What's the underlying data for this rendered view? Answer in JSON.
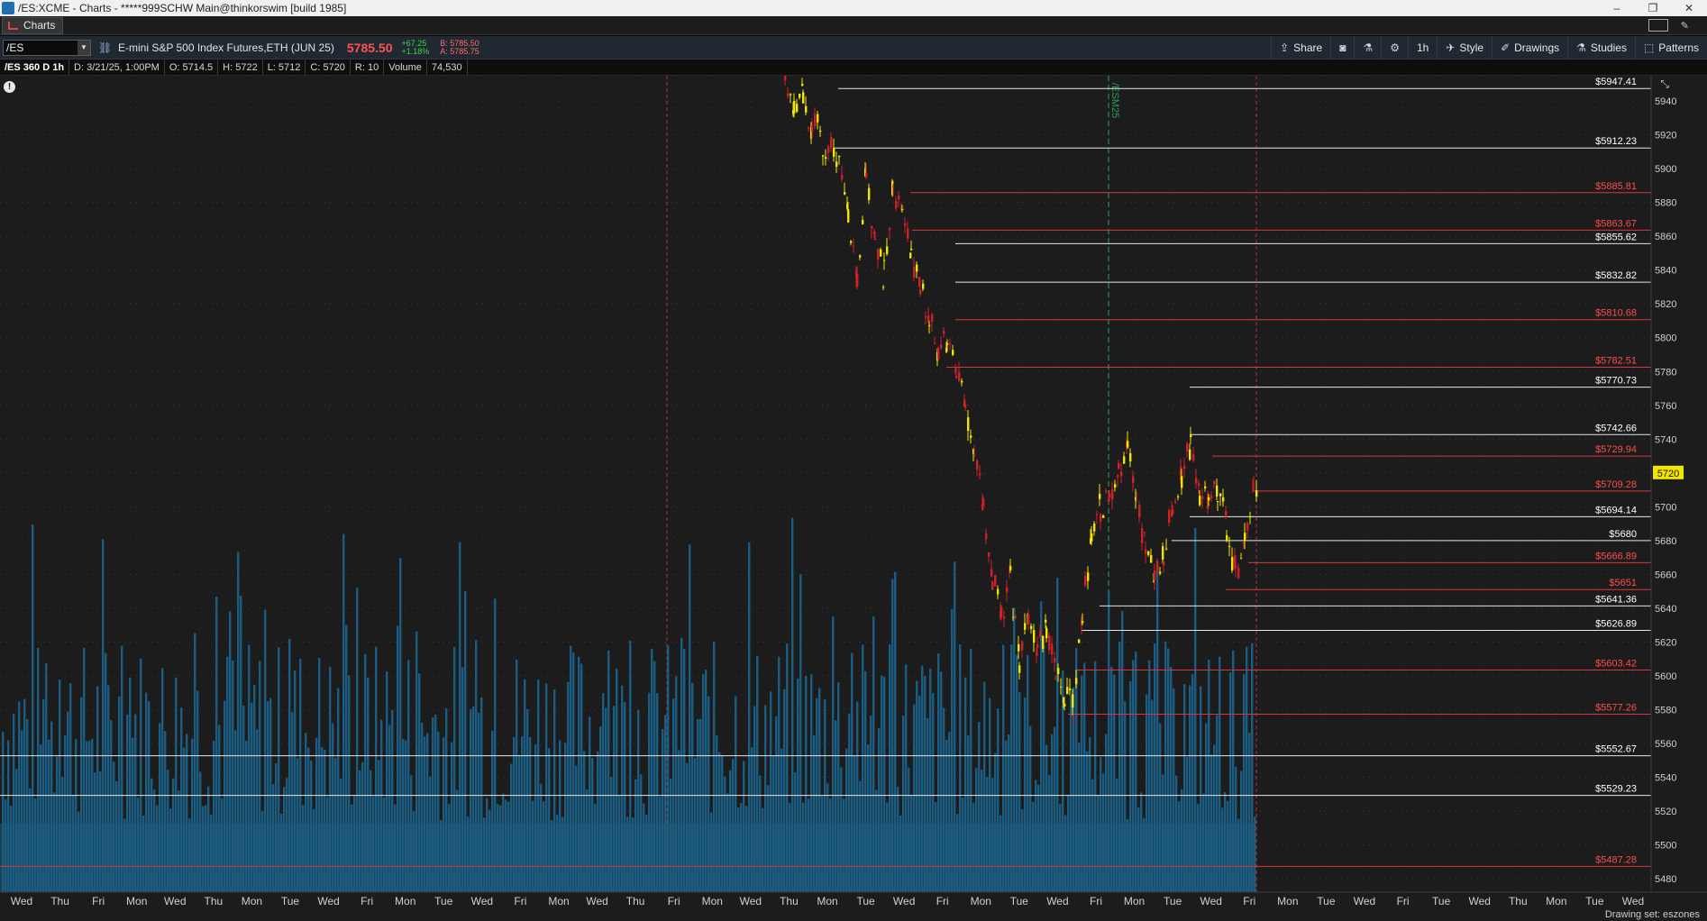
{
  "window": {
    "title": "/ES:XCME - Charts - *****999SCHW Main@thinkorswim [build 1985]",
    "controls": [
      "–",
      "❐",
      "✕"
    ]
  },
  "tab": {
    "label": "Charts"
  },
  "toolbar": {
    "symbol": "/ES",
    "instrument": "E-mini S&P 500 Index Futures,ETH (JUN 25)",
    "last_price": "5785.50",
    "change": "+67.25",
    "change_pct": "+1.18%",
    "bid": "B: 5785.50",
    "ask": "A: 5785.75",
    "share_label": "Share",
    "interval_label": "1h",
    "style_label": "Style",
    "drawings_label": "Drawings",
    "studies_label": "Studies",
    "patterns_label": "Patterns",
    "colors": {
      "up": "#3fd33f",
      "down": "#ff5252",
      "bar": "#1f2a36"
    }
  },
  "infobar": {
    "chart_name": "/ES 360 D 1h",
    "date": "D: 3/21/25, 1:00PM",
    "open": "O: 5714.5",
    "high": "H: 5722",
    "low": "L: 5712",
    "close": "C: 5720",
    "range": "R: 10",
    "volume_label": "Volume",
    "volume_value": "74,530"
  },
  "status": {
    "drawing_set": "Drawing set: eszones"
  },
  "chart_data": {
    "type": "candlestick",
    "ylim": [
      5472,
      5955
    ],
    "y_ticks": [
      5940,
      5920,
      5900,
      5880,
      5860,
      5840,
      5820,
      5800,
      5780,
      5760,
      5740,
      5720,
      5700,
      5680,
      5660,
      5640,
      5620,
      5600,
      5580,
      5560,
      5540,
      5520,
      5500,
      5480
    ],
    "current_price_label": "5720",
    "x_ticks": [
      "Wed",
      "Thu",
      "Fri",
      "Mon",
      "Wed",
      "Thu",
      "Mon",
      "Tue",
      "Wed",
      "Fri",
      "Mon",
      "Tue",
      "Wed",
      "Fri",
      "Mon",
      "Wed",
      "Thu",
      "Fri",
      "Mon",
      "Wed",
      "Thu",
      "Mon",
      "Tue",
      "Wed",
      "Fri",
      "Mon",
      "Tue",
      "Wed",
      "Fri",
      "Mon",
      "Tue",
      "Wed",
      "Fri",
      "Mon",
      "Tue",
      "Wed",
      "Fri",
      "Tue",
      "Wed",
      "Thu",
      "Mon",
      "Tue",
      "Wed"
    ],
    "price_levels": [
      {
        "label": "$5947.41",
        "value": 5947.41,
        "color": "white",
        "start_day": "Tue"
      },
      {
        "label": "$5912.23",
        "value": 5912.23,
        "color": "white",
        "start_day": "Mon"
      },
      {
        "label": "$5885.81",
        "value": 5885.81,
        "color": "red",
        "start_day": "Wed"
      },
      {
        "label": "$5863.67",
        "value": 5863.67,
        "color": "red",
        "start_day": "Wed"
      },
      {
        "label": "$5855.62",
        "value": 5855.62,
        "color": "white",
        "start_day": "Thu"
      },
      {
        "label": "$5832.82",
        "value": 5832.82,
        "color": "white",
        "start_day": "Thu"
      },
      {
        "label": "$5810.68",
        "value": 5810.68,
        "color": "red",
        "start_day": "Thu"
      },
      {
        "label": "$5782.51",
        "value": 5782.51,
        "color": "red",
        "start_day": "Fri"
      },
      {
        "label": "$5770.73",
        "value": 5770.73,
        "color": "white",
        "start_day": "Wed"
      },
      {
        "label": "$5742.66",
        "value": 5742.66,
        "color": "white",
        "start_day": "Wed"
      },
      {
        "label": "$5729.94",
        "value": 5729.94,
        "color": "red",
        "start_day": "Wed"
      },
      {
        "label": "$5709.28",
        "value": 5709.28,
        "color": "red",
        "start_day": "Fri"
      },
      {
        "label": "$5694.14",
        "value": 5694.14,
        "color": "white",
        "start_day": "Wed"
      },
      {
        "label": "$5680",
        "value": 5680,
        "color": "white",
        "start_day": "Tue"
      },
      {
        "label": "$5666.89",
        "value": 5666.89,
        "color": "red",
        "start_day": "Thu"
      },
      {
        "label": "$5651",
        "value": 5651,
        "color": "red",
        "start_day": "Fri"
      },
      {
        "label": "$5641.36",
        "value": 5641.36,
        "color": "white",
        "start_day": "Fri"
      },
      {
        "label": "$5626.89",
        "value": 5626.89,
        "color": "white",
        "start_day": "Fri"
      },
      {
        "label": "$5603.42",
        "value": 5603.42,
        "color": "red",
        "start_day": "Thu"
      },
      {
        "label": "$5577.26",
        "value": 5577.26,
        "color": "red",
        "start_day": "Wed"
      },
      {
        "label": "$5552.67",
        "value": 5552.67,
        "color": "white",
        "start_day": "Wed"
      },
      {
        "label": "$5529.23",
        "value": 5529.23,
        "color": "white",
        "start_day": "Wed"
      },
      {
        "label": "$5487.28",
        "value": 5487.28,
        "color": "red",
        "start_day": "Wed"
      }
    ],
    "series": [
      {
        "name": "Volume",
        "type": "bar",
        "color": "#1b5d82"
      }
    ],
    "annotation": "/ESM25"
  }
}
